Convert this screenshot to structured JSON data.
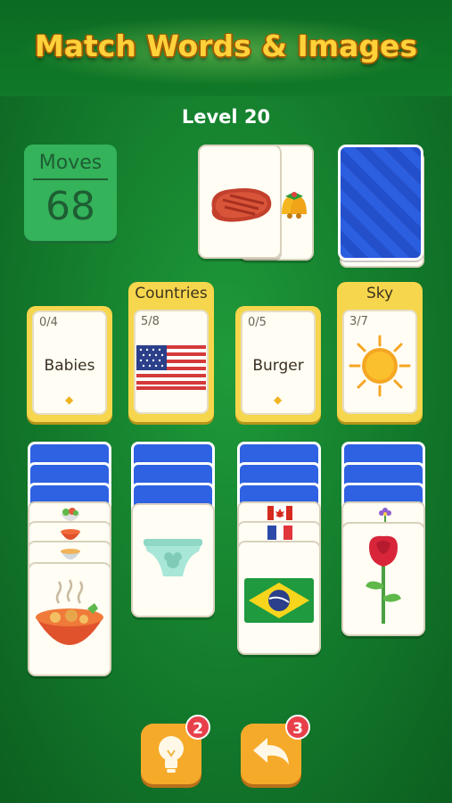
{
  "header": {
    "title": "Match Words & Images",
    "level": "Level 20"
  },
  "moves": {
    "label": "Moves",
    "value": "68"
  },
  "stock": {
    "top_card_icon": "steak-icon",
    "peek_icon": "bells-icon"
  },
  "foundations": [
    {
      "title": "",
      "count": "0/4",
      "word": "Babies",
      "icon": "gem-icon"
    },
    {
      "title": "Countries",
      "count": "5/8",
      "word": "",
      "icon": "usa-flag-icon"
    },
    {
      "title": "",
      "count": "0/5",
      "word": "Burger",
      "icon": "gem-icon"
    },
    {
      "title": "Sky",
      "count": "3/7",
      "word": "",
      "icon": "sun-icon"
    }
  ],
  "tableau": [
    {
      "icons": [
        "salad-icon",
        "tomato-soup-icon",
        "noodle-bowl-icon"
      ],
      "top": "stew-bowl-icon"
    },
    {
      "icons": [],
      "top": "diaper-icon"
    },
    {
      "icons": [
        "canada-flag-icon",
        "france-flag-icon"
      ],
      "top": "brazil-flag-icon"
    },
    {
      "icons": [
        "flower-icon"
      ],
      "top": "rose-icon"
    }
  ],
  "controls": {
    "hint_count": "2",
    "undo_count": "3"
  },
  "colors": {
    "background": "#137a2b",
    "accent": "#f6d64c",
    "card_back": "#2c5ee0",
    "button": "#f6aa2a",
    "badge": "#e8404a"
  }
}
